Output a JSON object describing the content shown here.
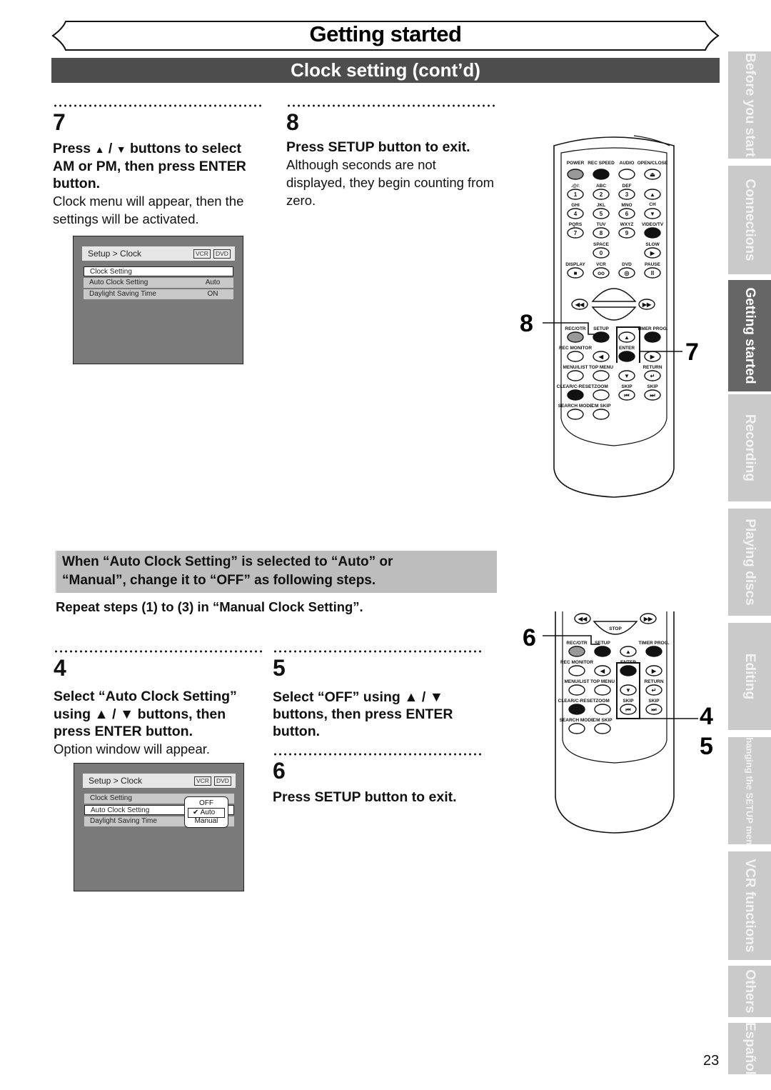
{
  "header": {
    "title": "Getting started",
    "subtitle": "Clock setting (cont’d)"
  },
  "steps_top": [
    {
      "number": "7",
      "instruction_parts": [
        "Press ",
        "▲",
        " / ",
        "▼",
        " buttons to select AM or PM, then press ENTER button."
      ],
      "note": "Clock menu will appear, then the settings will be activated."
    },
    {
      "number": "8",
      "instruction": "Press SETUP button to exit.",
      "note": "Although seconds are not displayed, they begin counting from zero."
    }
  ],
  "osd_clock": {
    "breadcrumb": "Setup > Clock",
    "tags": [
      "VCR",
      "DVD"
    ],
    "rows": [
      {
        "label": "Clock Setting",
        "value": "",
        "selected": true
      },
      {
        "label": "Auto Clock Setting",
        "value": "Auto",
        "selected": false
      },
      {
        "label": "Daylight Saving Time",
        "value": "ON",
        "selected": false
      }
    ]
  },
  "notice": {
    "text_line1": "When “Auto Clock Setting” is selected to “Auto” or",
    "text_line2": "“Manual”, change it to “OFF” as following steps.",
    "repeat": "Repeat steps (1) to (3) in “Manual Clock Setting”."
  },
  "steps_bottom": [
    {
      "number": "4",
      "line1": "Select “Auto Clock Setting”",
      "line2": "using ▲ / ▼ buttons, then",
      "line3": "press ENTER button.",
      "note": "Option window will appear."
    },
    {
      "number": "5",
      "line1": "Select “OFF” using ▲ / ▼",
      "line2": "buttons, then press ENTER",
      "line3": "button."
    },
    {
      "number": "6",
      "instruction": "Press SETUP button to exit."
    }
  ],
  "osd_option": {
    "breadcrumb": "Setup > Clock",
    "tags": [
      "VCR",
      "DVD"
    ],
    "rows": [
      {
        "label": "Clock Setting",
        "selected": false
      },
      {
        "label": "Auto Clock Setting",
        "selected": true
      },
      {
        "label": "Daylight Saving Time",
        "selected": false
      }
    ],
    "options": [
      "OFF",
      "✔ Auto",
      "Manual"
    ],
    "checked_option": "Auto"
  },
  "remote_top": {
    "callouts": [
      "8",
      "7"
    ],
    "labels": {
      "power": "POWER",
      "rec_speed": "REC SPEED",
      "audio": "AUDIO",
      "open_close": "OPEN/CLOSE",
      "k1": ".@/:",
      "k2": "ABC",
      "k3": "DEF",
      "k4": "GHI",
      "k5": "JKL",
      "k6": "MNO",
      "k7": "PQRS",
      "k8": "TUV",
      "k9": "WXYZ",
      "video_tv": "VIDEO/TV",
      "ch": "CH",
      "space": "SPACE",
      "slow": "SLOW",
      "display": "DISPLAY",
      "vcr": "VCR",
      "dvd": "DVD",
      "pause": "PAUSE",
      "play": "PLAY",
      "stop": "STOP",
      "rec_otr": "REC/OTR",
      "setup": "SETUP",
      "timer_prog": "TIMER PROG.",
      "rec_monitor": "REC MONITOR",
      "enter": "ENTER",
      "menu_list": "MENU/LIST",
      "top_menu": "TOP MENU",
      "return": "RETURN",
      "clear_reset": "CLEAR/C-RESET",
      "zoom": "ZOOM",
      "skip": "SKIP",
      "search_mode": "SEARCH MODE",
      "cm_skip": "CM SKIP"
    },
    "digits": [
      "1",
      "2",
      "3",
      "4",
      "5",
      "6",
      "7",
      "8",
      "9",
      "0"
    ]
  },
  "remote_bottom": {
    "callouts": [
      "6",
      "4",
      "5"
    ]
  },
  "side_tabs": [
    {
      "label": "Before you start",
      "active": false
    },
    {
      "label": "Connections",
      "active": false
    },
    {
      "label": "Getting started",
      "active": true
    },
    {
      "label": "Recording",
      "active": false
    },
    {
      "label": "Playing discs",
      "active": false
    },
    {
      "label": "Editing",
      "active": false
    },
    {
      "label": "Changing the SETUP menu",
      "active": false
    },
    {
      "label": "VCR functions",
      "active": false
    },
    {
      "label": "Others",
      "active": false
    },
    {
      "label": "Español",
      "active": false
    }
  ],
  "page_number": "23"
}
